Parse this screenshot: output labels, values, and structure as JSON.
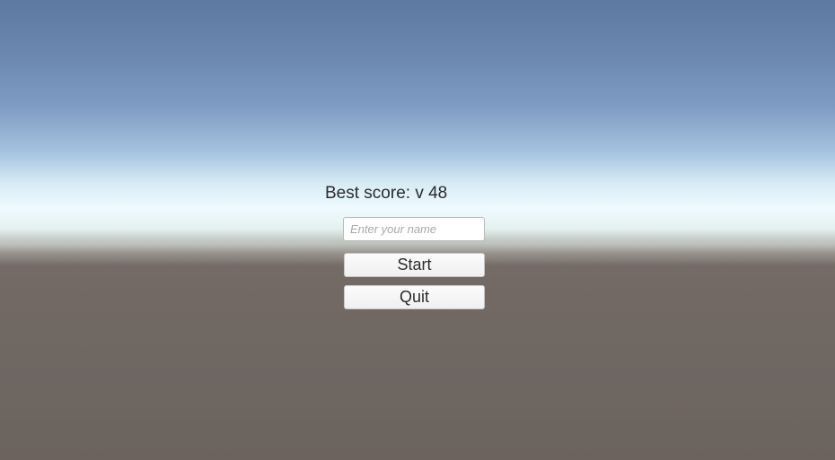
{
  "menu": {
    "best_score": "Best score: v 48",
    "name_input": {
      "value": "",
      "placeholder": "Enter your name"
    },
    "start_label": "Start",
    "quit_label": "Quit"
  },
  "colors": {
    "sky_top": "#5d79a0",
    "horizon": "#eefaff",
    "ground": "#6f6762",
    "button_bg": "#f5f5f5",
    "text": "#2b2b2b"
  }
}
